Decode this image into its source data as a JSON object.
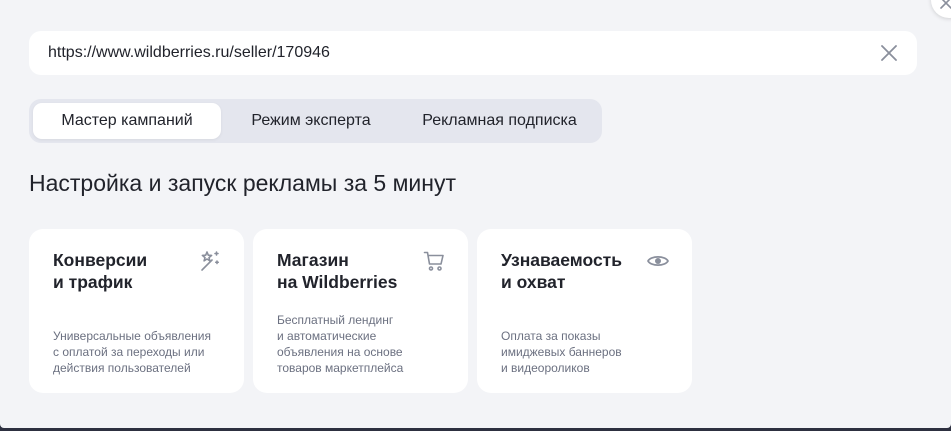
{
  "url_field": {
    "value": "https://www.wildberries.ru/seller/170946",
    "clear_icon": "close-icon"
  },
  "tabs": [
    {
      "label": "Мастер кампаний",
      "active": true
    },
    {
      "label": "Режим эксперта",
      "active": false
    },
    {
      "label": "Рекламная подписка",
      "active": false
    }
  ],
  "headline": "Настройка и запуск рекламы за 5 минут",
  "cards": [
    {
      "title_lines": [
        "Конверсии",
        "и трафик"
      ],
      "icon": "magic-wand-icon",
      "desc_lines": [
        "Универсальные объявления",
        "с оплатой за переходы или",
        "действия пользователей"
      ]
    },
    {
      "title_lines": [
        "Магазин",
        "на Wildberries"
      ],
      "icon": "cart-icon",
      "desc_lines": [
        "Бесплатный лендинг",
        "и автоматические",
        "объявления на основе",
        "товаров маркетплейса"
      ]
    },
    {
      "title_lines": [
        "Узнаваемость",
        "и охват"
      ],
      "icon": "eye-icon",
      "desc_lines": [
        "Оплата за показы",
        "имиджевых баннеров",
        "и видеороликов"
      ]
    }
  ],
  "colors": {
    "background": "#f3f4f7",
    "surface": "#ffffff",
    "tab_track": "#e4e6ee",
    "text_primary": "#21232b",
    "text_secondary": "#6b7080",
    "icon": "#8a8f9c"
  }
}
